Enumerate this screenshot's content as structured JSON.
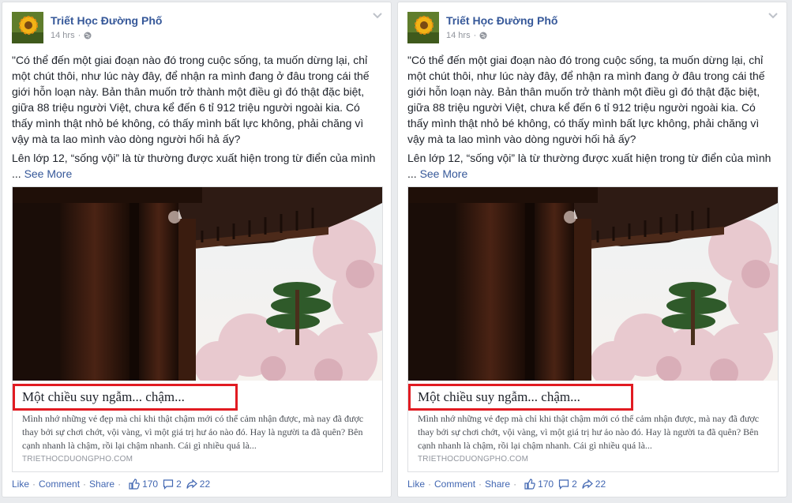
{
  "posts": [
    {
      "page_name": "Triết Học Đường Phố",
      "time": "14 hrs",
      "paragraph1": "\"Có thể đến một giai đoạn nào đó trong cuộc sống, ta muốn dừng lại, chỉ một chút thôi, như lúc này đây, để nhận ra mình đang ở đâu trong cái thế giới hỗn loạn này. Bản thân muốn trở thành một điều gì đó thật đặc biệt, giữa 88 triệu người Việt, chưa kể đến 6 tỉ 912 triệu người ngoài kia. Có thấy mình thật nhỏ bé không, có thấy mình bất lực không, phải chăng vì vậy mà ta lao mình vào dòng người hối hả ấy?",
      "paragraph2": "Lên lớp 12, “sống vội” là từ thường được xuất hiện trong từ điển của mình",
      "ellipsis": "...",
      "see_more": "See More",
      "link": {
        "title": "Một chiều suy ngẫm... chậm...",
        "description": "Mình nhớ những vẻ đẹp mà chỉ khi thật chậm mới có thể cảm nhận được, mà nay đã được thay bởi sự chơi chớt, vội vàng, vì một giá trị hư ảo nào đó. Hay là người ta đã quên? Bên cạnh nhanh là chậm, rồi lại chậm nhanh. Cái gì nhiều quá là...",
        "domain": "TRIETHOCDUONGPHO.COM"
      },
      "actions": {
        "like": "Like",
        "comment": "Comment",
        "share": "Share",
        "separator": "·",
        "likes_count": "170",
        "comments_count": "2",
        "shares_count": "22"
      }
    },
    {
      "page_name": "Triết Học Đường Phố",
      "time": "14 hrs",
      "paragraph1": "\"Có thể đến một giai đoạn nào đó trong cuộc sống, ta muốn dừng lại, chỉ một chút thôi, như lúc này đây, để nhận ra mình đang ở đâu trong cái thế giới hỗn loạn này. Bản thân muốn trở thành một điều gì đó thật đặc biệt, giữa 88 triệu người Việt, chưa kể đến 6 tỉ 912 triệu người ngoài kia. Có thấy mình thật nhỏ bé không, có thấy mình bất lực không, phải chăng vì vậy mà ta lao mình vào dòng người hối hả ấy?",
      "paragraph2": "Lên lớp 12, “sống vội” là từ thường được xuất hiện trong từ điển của mình",
      "ellipsis": "...",
      "see_more": "See More",
      "link": {
        "title": "Một chiều suy ngẫm... chậm...",
        "description": "Mình nhớ những vẻ đẹp mà chỉ khi thật chậm mới có thể cảm nhận được, mà nay đã được thay bởi sự chơi chớt, vội vàng, vì một giá trị hư ảo nào đó. Hay là người ta đã quên? Bên cạnh nhanh là chậm, rồi lại chậm nhanh. Cái gì nhiều quá là...",
        "domain": "TRIETHOCDUONGPHO.COM"
      },
      "actions": {
        "like": "Like",
        "comment": "Comment",
        "share": "Share",
        "separator": "·",
        "likes_count": "170",
        "comments_count": "2",
        "shares_count": "22"
      }
    }
  ],
  "icons": {
    "privacy": "globe-icon",
    "menu": "chevron-down-icon",
    "like": "thumbs-up-icon",
    "comment": "speech-bubble-icon",
    "share": "share-arrow-icon"
  },
  "colors": {
    "link_blue": "#365899",
    "action_blue": "#4267b2",
    "highlight_red": "#e11b22",
    "text": "#1d2129",
    "muted": "#90949c"
  }
}
